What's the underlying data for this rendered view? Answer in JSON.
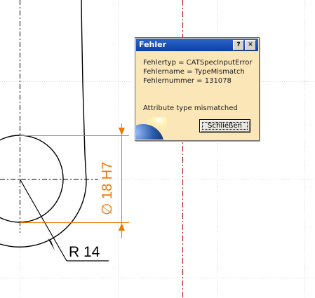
{
  "drawing": {
    "dimension_text": "∅ 18 H7",
    "radius_text": "R 14",
    "colors": {
      "grid": "#d4d4d4",
      "dimension": "#f07800",
      "red_axis": "#c00000",
      "geometry": "#000000"
    }
  },
  "dialog": {
    "title": "Fehler",
    "help_button": "?",
    "close_button": "✕",
    "lines": [
      "Fehlertyp = CATSpecInputError",
      "Fehlername = TypeMismatch",
      "Fehlernummer = 131078"
    ],
    "message": "Attribute type mismatched",
    "ok_label": "Schließen",
    "icon": "globe-icon"
  }
}
